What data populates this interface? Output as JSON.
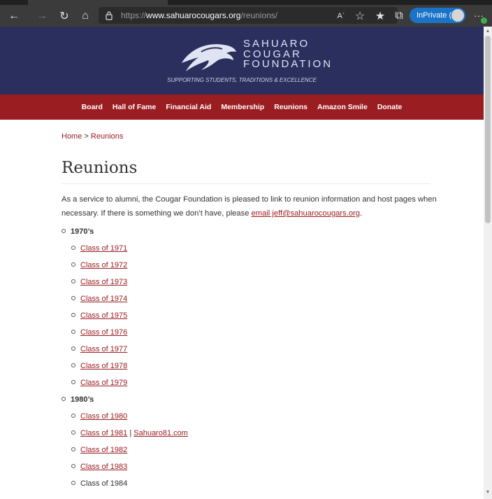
{
  "browser": {
    "url_proto": "https://",
    "url_host": "www.sahuarocougars.org",
    "url_path": "/reunions/",
    "inprivate_label": "InPrivate (3)",
    "more_label": "···"
  },
  "site": {
    "brand_lines": [
      "SAHUARO",
      "COUGAR",
      "FOUNDATION"
    ],
    "tagline": "SUPPORTING STUDENTS, TRADITIONS & EXCELLENCE",
    "nav": [
      "Board",
      "Hall of Fame",
      "Financial Aid",
      "Membership",
      "Reunions",
      "Amazon Smile",
      "Donate"
    ],
    "colors": {
      "header": "#2a2f5e",
      "nav": "#9a1d21",
      "link": "#9a1d21"
    }
  },
  "page": {
    "breadcrumb_home": "Home",
    "breadcrumb_sep": ">",
    "breadcrumb_current": "Reunions",
    "title": "Reunions",
    "intro_text": "As a service to alumni, the Cougar Foundation is pleased to link to reunion information and host pages when necessary.  If there is something we don’t have, please ",
    "intro_link": "email jeff@sahuarocougars.org",
    "intro_end": ".",
    "decades": [
      {
        "label": "1970’s",
        "classes": [
          "Class of 1971",
          "Class of 1972",
          "Class of 1973",
          "Class of 1974",
          "Class of 1975",
          "Class of 1976",
          "Class of 1977",
          "Class of 1978",
          "Class of 1979"
        ]
      },
      {
        "label": "1980’s",
        "classes": [
          "Class of 1980",
          "Class of 1981",
          "Class of 1982",
          "Class of 1983",
          "Class of 1984"
        ]
      }
    ],
    "class_1981_extra_sep": "|",
    "class_1981_extra_link": "Sahuaro81.com"
  }
}
